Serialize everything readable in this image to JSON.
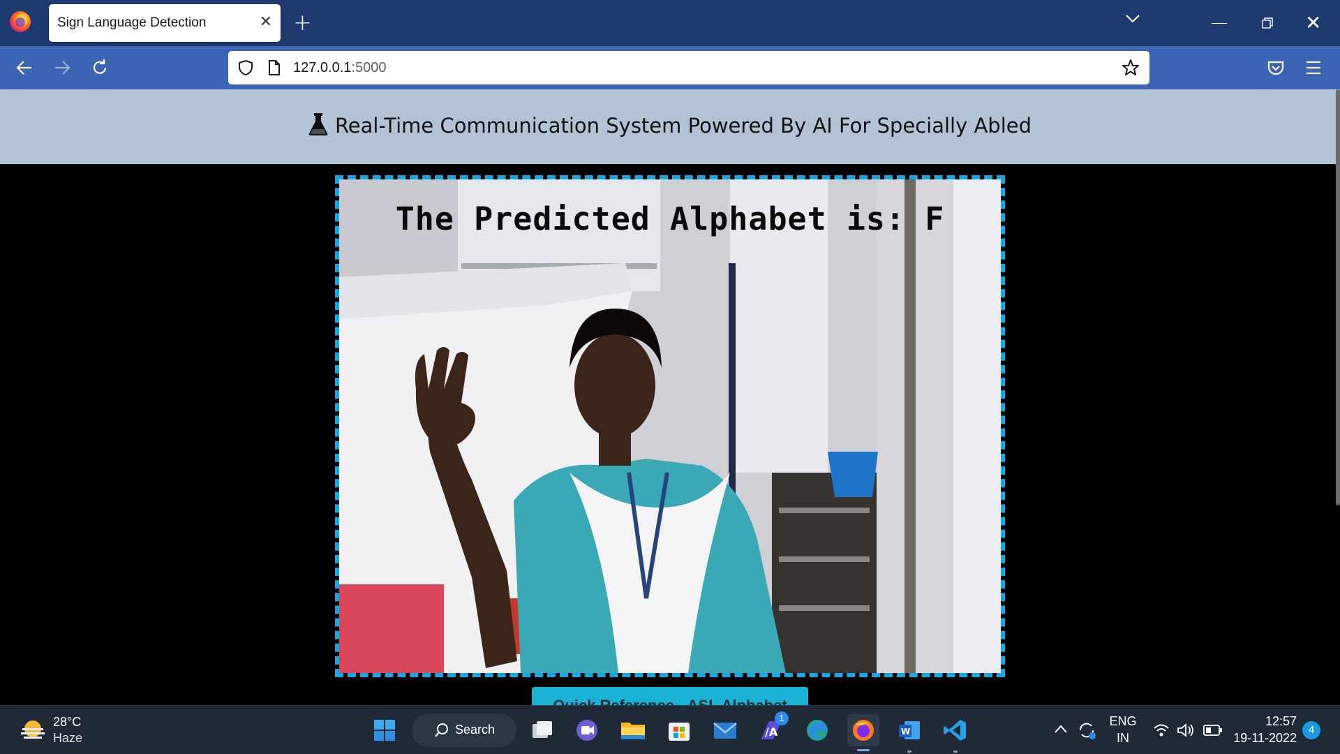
{
  "browser": {
    "tab_title": "Sign Language Detection",
    "tab_close_glyph": "✕",
    "new_tab_glyph": "+",
    "url_host": "127.0.0.1",
    "url_port": ":5000",
    "close_window_glyph": "✕"
  },
  "page": {
    "header_title": "Real-Time Communication System Powered By AI For Specially Abled",
    "prediction_text": "The Predicted Alphabet is: F",
    "bottom_button_label": "Quick Reference - ASL Alphabet",
    "colors": {
      "header_bg": "#b3c3d6",
      "frame_border": "#1aa7e0",
      "button_bg": "#1ab3d6"
    }
  },
  "taskbar": {
    "weather_temp": "28°C",
    "weather_condition": "Haze",
    "search_label": "Search",
    "lang_primary": "ENG",
    "lang_secondary": "IN",
    "time": "12:57",
    "date": "19-11-2022",
    "notification_count": "4",
    "teams_badge": "1",
    "apps": [
      "start-icon",
      "search-icon",
      "task-view-icon",
      "teams-chat-icon",
      "file-explorer-icon",
      "microsoft-store-icon",
      "mail-icon",
      "ai-app-icon",
      "edge-icon",
      "firefox-icon",
      "word-icon",
      "vscode-icon"
    ]
  }
}
